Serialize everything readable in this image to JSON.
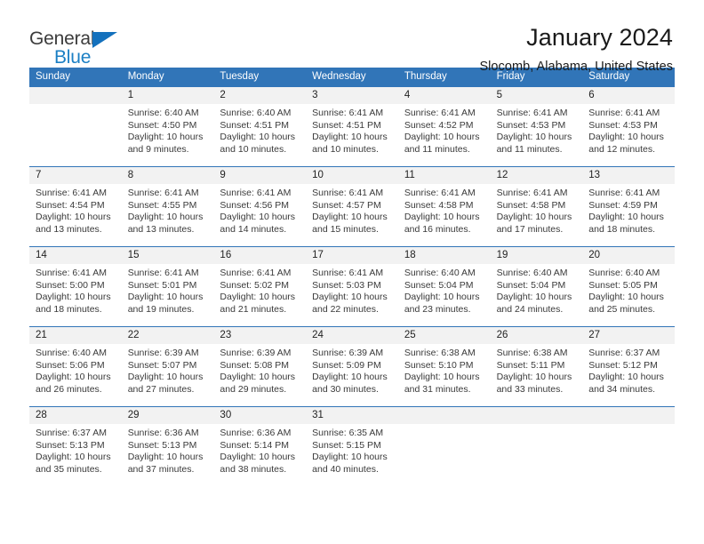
{
  "brand": {
    "name_part1": "General",
    "name_part2": "Blue",
    "accent_color": "#1b7fc4"
  },
  "header": {
    "title": "January 2024",
    "subtitle": "Slocomb, Alabama, United States"
  },
  "theme": {
    "header_blue": "#3175b8",
    "daynum_band": "#f2f2f2"
  },
  "weekdays": [
    "Sunday",
    "Monday",
    "Tuesday",
    "Wednesday",
    "Thursday",
    "Friday",
    "Saturday"
  ],
  "weeks": [
    {
      "days": [
        {
          "num": "",
          "sunrise": "",
          "sunset": "",
          "daylight_line1": "",
          "daylight_line2": ""
        },
        {
          "num": "1",
          "sunrise": "Sunrise: 6:40 AM",
          "sunset": "Sunset: 4:50 PM",
          "daylight_line1": "Daylight: 10 hours",
          "daylight_line2": "and 9 minutes."
        },
        {
          "num": "2",
          "sunrise": "Sunrise: 6:40 AM",
          "sunset": "Sunset: 4:51 PM",
          "daylight_line1": "Daylight: 10 hours",
          "daylight_line2": "and 10 minutes."
        },
        {
          "num": "3",
          "sunrise": "Sunrise: 6:41 AM",
          "sunset": "Sunset: 4:51 PM",
          "daylight_line1": "Daylight: 10 hours",
          "daylight_line2": "and 10 minutes."
        },
        {
          "num": "4",
          "sunrise": "Sunrise: 6:41 AM",
          "sunset": "Sunset: 4:52 PM",
          "daylight_line1": "Daylight: 10 hours",
          "daylight_line2": "and 11 minutes."
        },
        {
          "num": "5",
          "sunrise": "Sunrise: 6:41 AM",
          "sunset": "Sunset: 4:53 PM",
          "daylight_line1": "Daylight: 10 hours",
          "daylight_line2": "and 11 minutes."
        },
        {
          "num": "6",
          "sunrise": "Sunrise: 6:41 AM",
          "sunset": "Sunset: 4:53 PM",
          "daylight_line1": "Daylight: 10 hours",
          "daylight_line2": "and 12 minutes."
        }
      ]
    },
    {
      "days": [
        {
          "num": "7",
          "sunrise": "Sunrise: 6:41 AM",
          "sunset": "Sunset: 4:54 PM",
          "daylight_line1": "Daylight: 10 hours",
          "daylight_line2": "and 13 minutes."
        },
        {
          "num": "8",
          "sunrise": "Sunrise: 6:41 AM",
          "sunset": "Sunset: 4:55 PM",
          "daylight_line1": "Daylight: 10 hours",
          "daylight_line2": "and 13 minutes."
        },
        {
          "num": "9",
          "sunrise": "Sunrise: 6:41 AM",
          "sunset": "Sunset: 4:56 PM",
          "daylight_line1": "Daylight: 10 hours",
          "daylight_line2": "and 14 minutes."
        },
        {
          "num": "10",
          "sunrise": "Sunrise: 6:41 AM",
          "sunset": "Sunset: 4:57 PM",
          "daylight_line1": "Daylight: 10 hours",
          "daylight_line2": "and 15 minutes."
        },
        {
          "num": "11",
          "sunrise": "Sunrise: 6:41 AM",
          "sunset": "Sunset: 4:58 PM",
          "daylight_line1": "Daylight: 10 hours",
          "daylight_line2": "and 16 minutes."
        },
        {
          "num": "12",
          "sunrise": "Sunrise: 6:41 AM",
          "sunset": "Sunset: 4:58 PM",
          "daylight_line1": "Daylight: 10 hours",
          "daylight_line2": "and 17 minutes."
        },
        {
          "num": "13",
          "sunrise": "Sunrise: 6:41 AM",
          "sunset": "Sunset: 4:59 PM",
          "daylight_line1": "Daylight: 10 hours",
          "daylight_line2": "and 18 minutes."
        }
      ]
    },
    {
      "days": [
        {
          "num": "14",
          "sunrise": "Sunrise: 6:41 AM",
          "sunset": "Sunset: 5:00 PM",
          "daylight_line1": "Daylight: 10 hours",
          "daylight_line2": "and 18 minutes."
        },
        {
          "num": "15",
          "sunrise": "Sunrise: 6:41 AM",
          "sunset": "Sunset: 5:01 PM",
          "daylight_line1": "Daylight: 10 hours",
          "daylight_line2": "and 19 minutes."
        },
        {
          "num": "16",
          "sunrise": "Sunrise: 6:41 AM",
          "sunset": "Sunset: 5:02 PM",
          "daylight_line1": "Daylight: 10 hours",
          "daylight_line2": "and 21 minutes."
        },
        {
          "num": "17",
          "sunrise": "Sunrise: 6:41 AM",
          "sunset": "Sunset: 5:03 PM",
          "daylight_line1": "Daylight: 10 hours",
          "daylight_line2": "and 22 minutes."
        },
        {
          "num": "18",
          "sunrise": "Sunrise: 6:40 AM",
          "sunset": "Sunset: 5:04 PM",
          "daylight_line1": "Daylight: 10 hours",
          "daylight_line2": "and 23 minutes."
        },
        {
          "num": "19",
          "sunrise": "Sunrise: 6:40 AM",
          "sunset": "Sunset: 5:04 PM",
          "daylight_line1": "Daylight: 10 hours",
          "daylight_line2": "and 24 minutes."
        },
        {
          "num": "20",
          "sunrise": "Sunrise: 6:40 AM",
          "sunset": "Sunset: 5:05 PM",
          "daylight_line1": "Daylight: 10 hours",
          "daylight_line2": "and 25 minutes."
        }
      ]
    },
    {
      "days": [
        {
          "num": "21",
          "sunrise": "Sunrise: 6:40 AM",
          "sunset": "Sunset: 5:06 PM",
          "daylight_line1": "Daylight: 10 hours",
          "daylight_line2": "and 26 minutes."
        },
        {
          "num": "22",
          "sunrise": "Sunrise: 6:39 AM",
          "sunset": "Sunset: 5:07 PM",
          "daylight_line1": "Daylight: 10 hours",
          "daylight_line2": "and 27 minutes."
        },
        {
          "num": "23",
          "sunrise": "Sunrise: 6:39 AM",
          "sunset": "Sunset: 5:08 PM",
          "daylight_line1": "Daylight: 10 hours",
          "daylight_line2": "and 29 minutes."
        },
        {
          "num": "24",
          "sunrise": "Sunrise: 6:39 AM",
          "sunset": "Sunset: 5:09 PM",
          "daylight_line1": "Daylight: 10 hours",
          "daylight_line2": "and 30 minutes."
        },
        {
          "num": "25",
          "sunrise": "Sunrise: 6:38 AM",
          "sunset": "Sunset: 5:10 PM",
          "daylight_line1": "Daylight: 10 hours",
          "daylight_line2": "and 31 minutes."
        },
        {
          "num": "26",
          "sunrise": "Sunrise: 6:38 AM",
          "sunset": "Sunset: 5:11 PM",
          "daylight_line1": "Daylight: 10 hours",
          "daylight_line2": "and 33 minutes."
        },
        {
          "num": "27",
          "sunrise": "Sunrise: 6:37 AM",
          "sunset": "Sunset: 5:12 PM",
          "daylight_line1": "Daylight: 10 hours",
          "daylight_line2": "and 34 minutes."
        }
      ]
    },
    {
      "days": [
        {
          "num": "28",
          "sunrise": "Sunrise: 6:37 AM",
          "sunset": "Sunset: 5:13 PM",
          "daylight_line1": "Daylight: 10 hours",
          "daylight_line2": "and 35 minutes."
        },
        {
          "num": "29",
          "sunrise": "Sunrise: 6:36 AM",
          "sunset": "Sunset: 5:13 PM",
          "daylight_line1": "Daylight: 10 hours",
          "daylight_line2": "and 37 minutes."
        },
        {
          "num": "30",
          "sunrise": "Sunrise: 6:36 AM",
          "sunset": "Sunset: 5:14 PM",
          "daylight_line1": "Daylight: 10 hours",
          "daylight_line2": "and 38 minutes."
        },
        {
          "num": "31",
          "sunrise": "Sunrise: 6:35 AM",
          "sunset": "Sunset: 5:15 PM",
          "daylight_line1": "Daylight: 10 hours",
          "daylight_line2": "and 40 minutes."
        },
        {
          "num": "",
          "sunrise": "",
          "sunset": "",
          "daylight_line1": "",
          "daylight_line2": ""
        },
        {
          "num": "",
          "sunrise": "",
          "sunset": "",
          "daylight_line1": "",
          "daylight_line2": ""
        },
        {
          "num": "",
          "sunrise": "",
          "sunset": "",
          "daylight_line1": "",
          "daylight_line2": ""
        }
      ]
    }
  ]
}
